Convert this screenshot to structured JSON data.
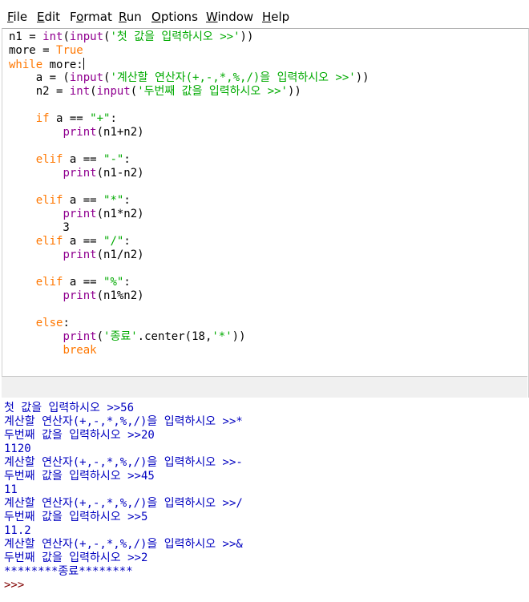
{
  "menu": {
    "file": {
      "u": "F",
      "rest": "ile"
    },
    "edit": {
      "u": "E",
      "rest": "dit"
    },
    "format": {
      "pre": "F",
      "u": "o",
      "rest": "rmat"
    },
    "run": {
      "u": "R",
      "rest": "un"
    },
    "options": {
      "u": "O",
      "rest": "ptions"
    },
    "window": {
      "u": "W",
      "rest": "indow"
    },
    "help": {
      "u": "H",
      "rest": "elp"
    }
  },
  "code": {
    "l1": {
      "a": "n1 = ",
      "b": "int",
      "c": "(",
      "d": "input",
      "e": "(",
      "f": "'첫 값을 입력하시오 >>'",
      "g": "))"
    },
    "l2": {
      "a": "more = ",
      "b": "True"
    },
    "l3": {
      "a": "while",
      "b": " more:"
    },
    "l4": {
      "a": "    a = (",
      "b": "input",
      "c": "(",
      "d": "'계산할 연산자(+,-,*,%,/)을 입력하시오 >>'",
      "e": "))"
    },
    "l5": {
      "a": "    n2 = ",
      "b": "int",
      "c": "(",
      "d": "input",
      "e": "(",
      "f": "'두번째 값을 입력하시오 >>'",
      "g": "))"
    },
    "l6": {
      "a": "    ",
      "b": "if",
      "c": " a == ",
      "d": "\"+\"",
      "e": ":"
    },
    "l7": {
      "a": "        ",
      "b": "print",
      "c": "(n1+n2)"
    },
    "l8": {
      "a": "    ",
      "b": "elif",
      "c": " a == ",
      "d": "\"-\"",
      "e": ":"
    },
    "l9": {
      "a": "        ",
      "b": "print",
      "c": "(n1-n2)"
    },
    "l10": {
      "a": "    ",
      "b": "elif",
      "c": " a == ",
      "d": "\"*\"",
      "e": ":"
    },
    "l11": {
      "a": "        ",
      "b": "print",
      "c": "(n1*n2)"
    },
    "l12": {
      "a": "        3"
    },
    "l13": {
      "a": "    ",
      "b": "elif",
      "c": " a == ",
      "d": "\"/\"",
      "e": ":"
    },
    "l14": {
      "a": "        ",
      "b": "print",
      "c": "(n1/n2)"
    },
    "l15": {
      "a": "    ",
      "b": "elif",
      "c": " a == ",
      "d": "\"%\"",
      "e": ":"
    },
    "l16": {
      "a": "        ",
      "b": "print",
      "c": "(n1%n2)"
    },
    "l17": {
      "a": "    ",
      "b": "else",
      "c": ":"
    },
    "l18": {
      "a": "        ",
      "b": "print",
      "c": "(",
      "d": "'종료'",
      "e": ".center(18,",
      "f": "'*'",
      "g": "))"
    },
    "l19": {
      "a": "        ",
      "b": "break"
    }
  },
  "shell": {
    "lines": [
      "첫 값을 입력하시오 >>56",
      "계산할 연산자(+,-,*,%,/)을 입력하시오 >>*",
      "두번째 값을 입력하시오 >>20",
      "1120",
      "계산할 연산자(+,-,*,%,/)을 입력하시오 >>-",
      "두번째 값을 입력하시오 >>45",
      "11",
      "계산할 연산자(+,-,*,%,/)을 입력하시오 >>/",
      "두번째 값을 입력하시오 >>5",
      "11.2",
      "계산할 연산자(+,-,*,%,/)을 입력하시오 >>&",
      "두번째 값을 입력하시오 >>2",
      "********종료********"
    ],
    "prompt": ">>>"
  },
  "colors": {
    "keyword": "#ff7700",
    "builtin": "#900090",
    "string": "#00aa00",
    "output": "#0000c0",
    "prompt": "#800000"
  }
}
